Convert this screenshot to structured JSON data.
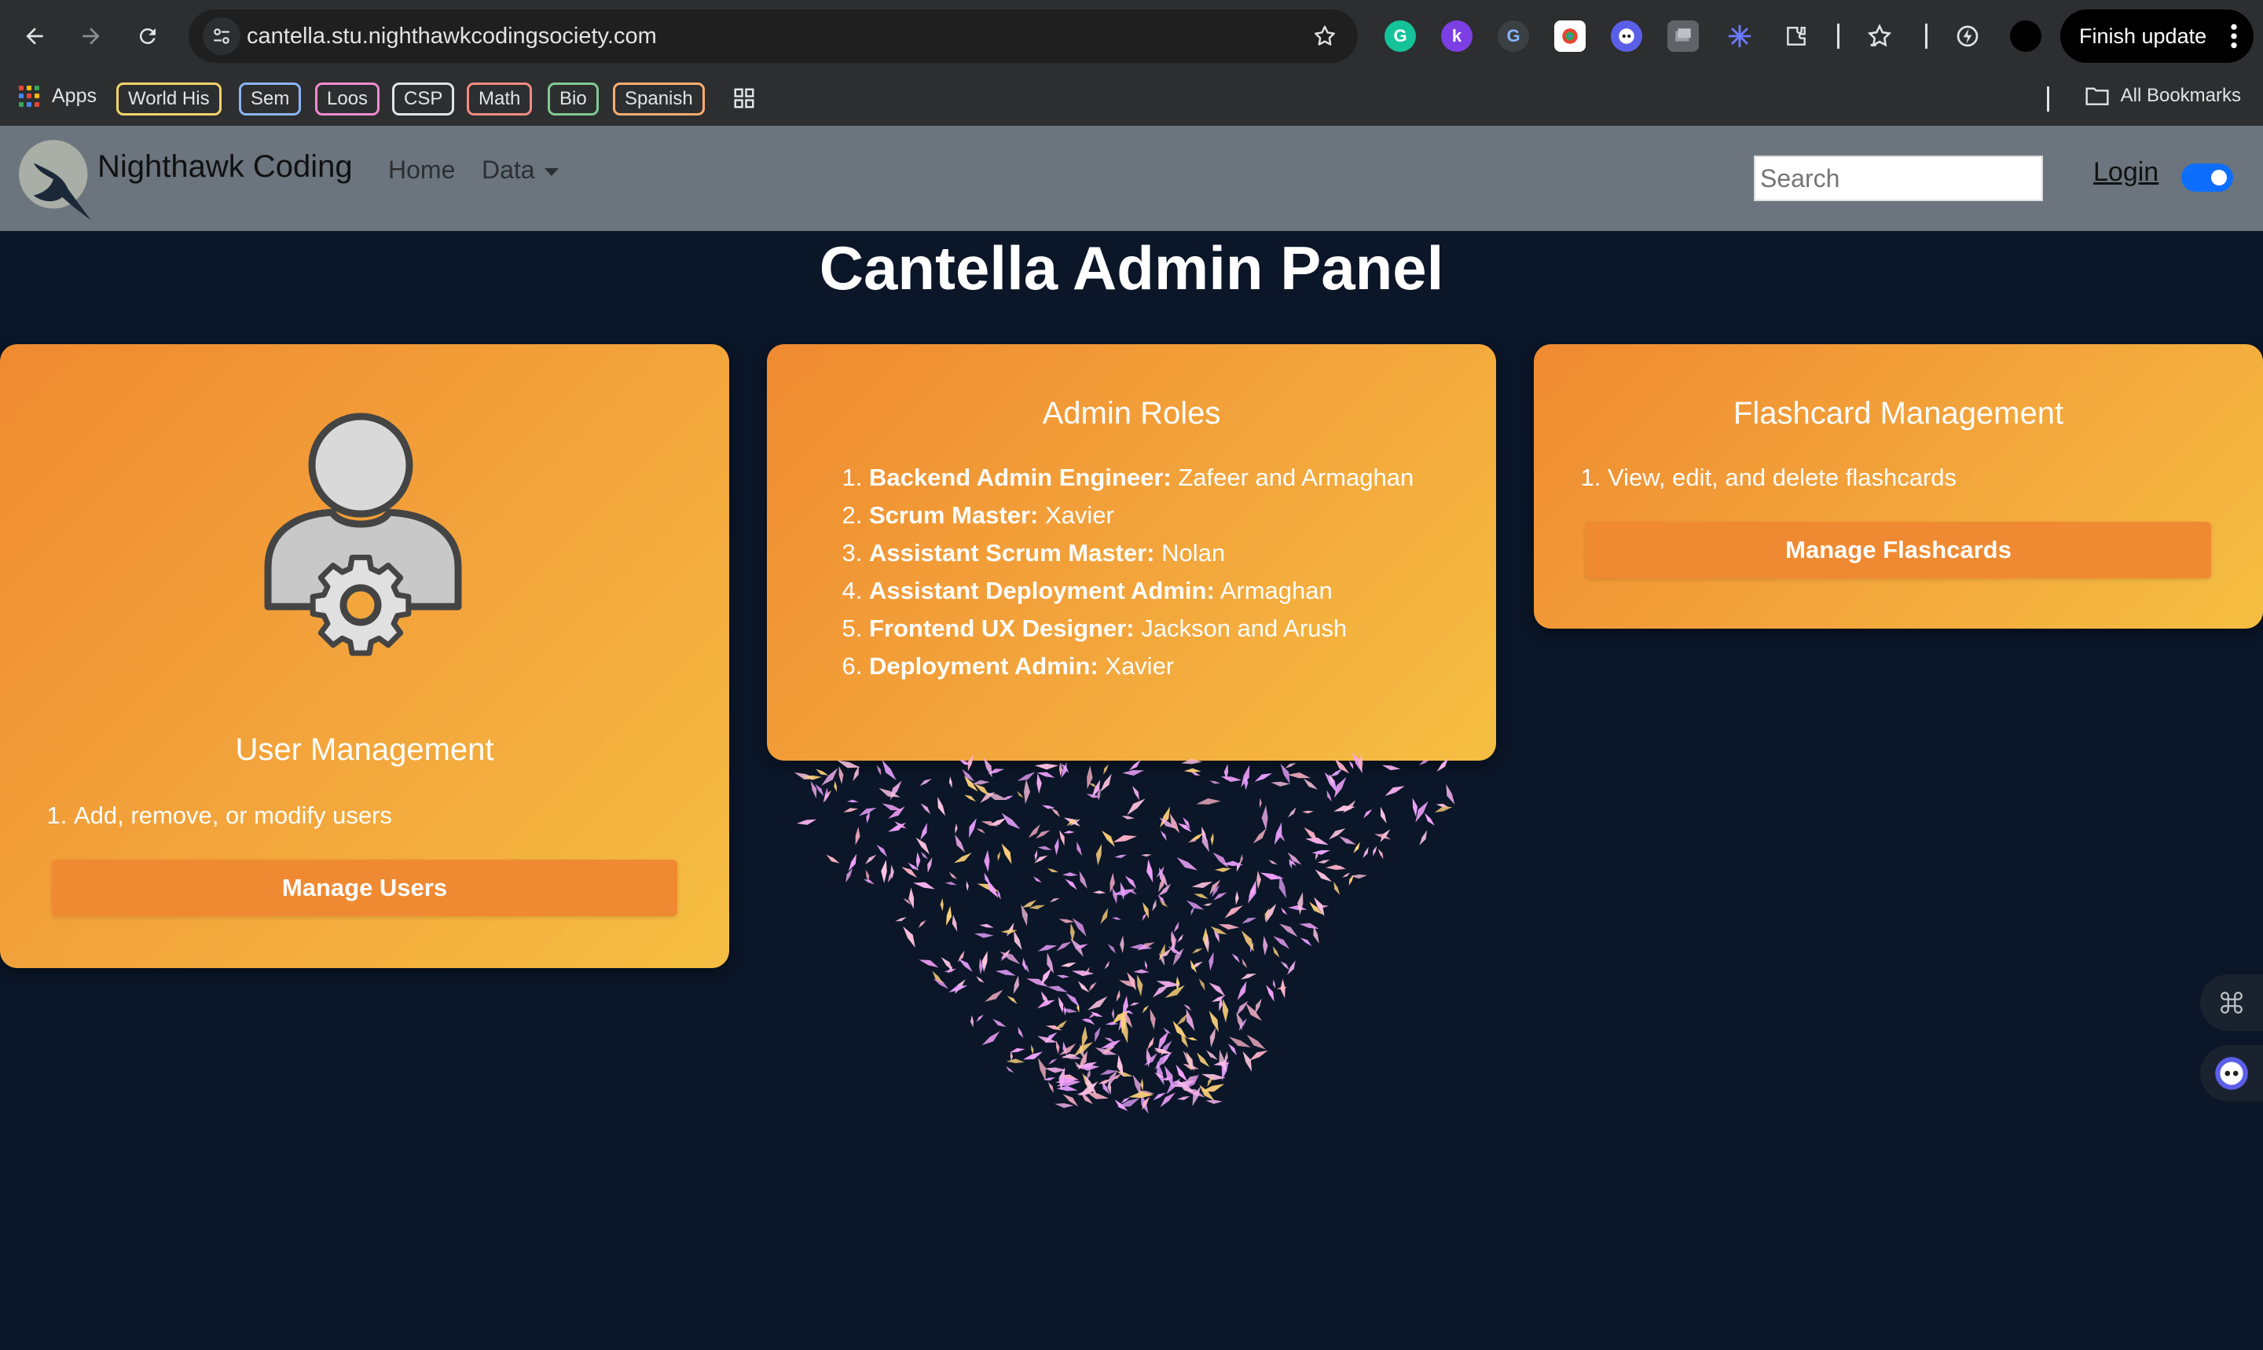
{
  "browser": {
    "url": "cantella.stu.nighthawkcodingsociety.com",
    "finish_update_label": "Finish update",
    "apps_label": "Apps",
    "all_bookmarks_label": "All Bookmarks",
    "bookmarks": [
      {
        "label": "World His",
        "color": "#f3d36b"
      },
      {
        "label": "Sem",
        "color": "#8ab4f8"
      },
      {
        "label": "Loos",
        "color": "#f28bd0"
      },
      {
        "label": "CSP",
        "color": "#e3e3e3"
      },
      {
        "label": "Math",
        "color": "#f28b82"
      },
      {
        "label": "Bio",
        "color": "#81c995"
      },
      {
        "label": "Spanish",
        "color": "#fcad70"
      }
    ]
  },
  "navbar": {
    "brand": "Nighthawk Coding",
    "links": [
      "Home",
      "Data"
    ],
    "search_placeholder": "Search",
    "login_label": "Login"
  },
  "page": {
    "title": "Cantella Admin Panel"
  },
  "cards": {
    "user_management": {
      "title": "User Management",
      "items": [
        "Add, remove, or modify users"
      ],
      "button_label": "Manage Users"
    },
    "admin_roles": {
      "title": "Admin Roles",
      "roles": [
        {
          "role": "Backend Admin Engineer:",
          "names": "Zafeer and Armaghan"
        },
        {
          "role": "Scrum Master:",
          "names": "Xavier"
        },
        {
          "role": "Assistant Scrum Master:",
          "names": "Nolan"
        },
        {
          "role": "Assistant Deployment Admin:",
          "names": "Armaghan"
        },
        {
          "role": "Frontend UX Designer:",
          "names": "Jackson and Arush"
        },
        {
          "role": "Deployment Admin:",
          "names": "Xavier"
        }
      ]
    },
    "flashcard_management": {
      "title": "Flashcard Management",
      "items": [
        "View, edit, and delete flashcards"
      ],
      "button_label": "Manage Flashcards"
    }
  },
  "colors": {
    "background": "#0b1628",
    "card_gradient_start": "#ef8a30",
    "card_gradient_end": "#f5bf42",
    "button": "#ef8a32",
    "navbar": "#6c757d",
    "toggle": "#0d6efd"
  }
}
